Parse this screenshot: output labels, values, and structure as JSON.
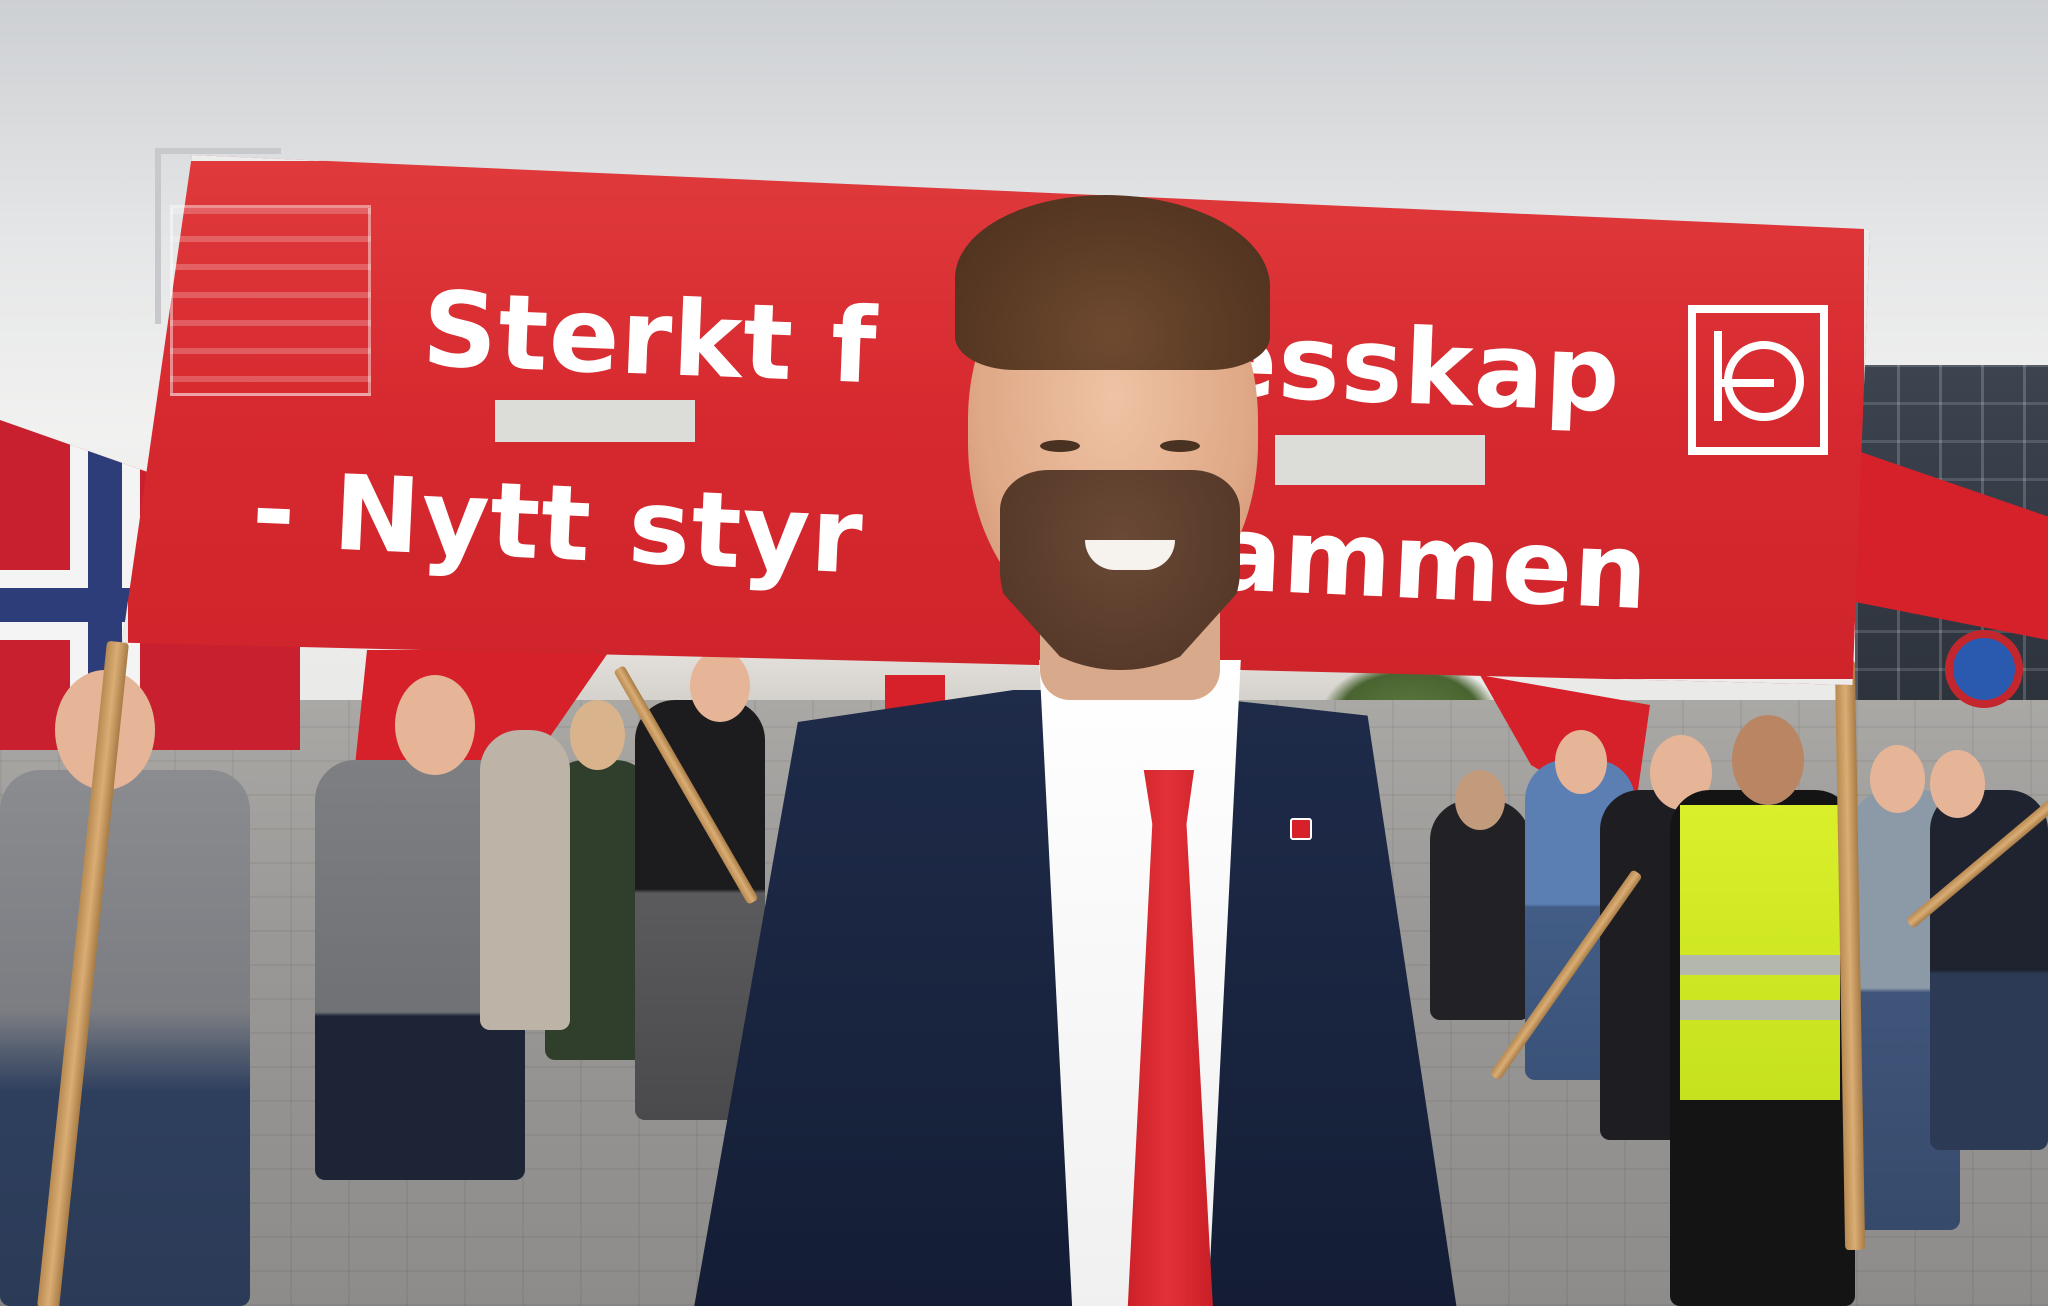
{
  "photo": {
    "banner": {
      "line1": "Sterkt f",
      "line1b": "esskap",
      "line2": "- Nytt styr",
      "line2b": "Drammen",
      "logo": "LO"
    },
    "colors": {
      "banner_red": "#d6292f",
      "suit_navy": "#1e2b49",
      "tie_red": "#e33138",
      "vest_yellow": "#d9ef2a"
    }
  }
}
